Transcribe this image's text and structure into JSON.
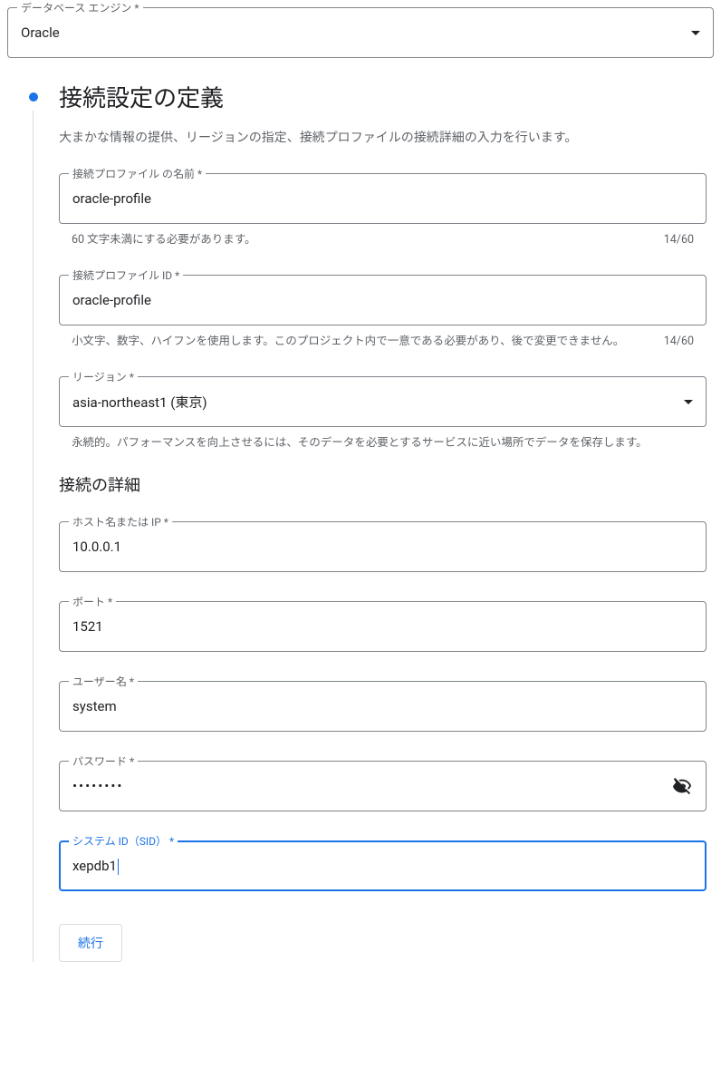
{
  "engine": {
    "label": "データベース エンジン *",
    "value": "Oracle"
  },
  "section": {
    "title": "接続設定の定義",
    "description": "大まかな情報の提供、リージョンの指定、接続プロファイルの接続詳細の入力を行います。"
  },
  "profileName": {
    "label": "接続プロファイル の名前 *",
    "value": "oracle-profile",
    "helper": "60 文字未満にする必要があります。",
    "counter": "14/60"
  },
  "profileId": {
    "label": "接続プロファイル ID *",
    "value": "oracle-profile",
    "helper": "小文字、数字、ハイフンを使用します。このプロジェクト内で一意である必要があり、後で変更できません。",
    "counter": "14/60"
  },
  "region": {
    "label": "リージョン *",
    "value": "asia-northeast1 (東京)",
    "helper": "永続的。パフォーマンスを向上させるには、そのデータを必要とするサービスに近い場所でデータを保存します。"
  },
  "detailsHeading": "接続の詳細",
  "host": {
    "label": "ホスト名または IP *",
    "value": "10.0.0.1"
  },
  "port": {
    "label": "ポート *",
    "value": "1521"
  },
  "username": {
    "label": "ユーザー名 *",
    "value": "system"
  },
  "password": {
    "label": "パスワード *",
    "masked": "••••••••"
  },
  "sid": {
    "label": "システム ID（SID） *",
    "value": "xepdb1"
  },
  "continueLabel": "続行"
}
